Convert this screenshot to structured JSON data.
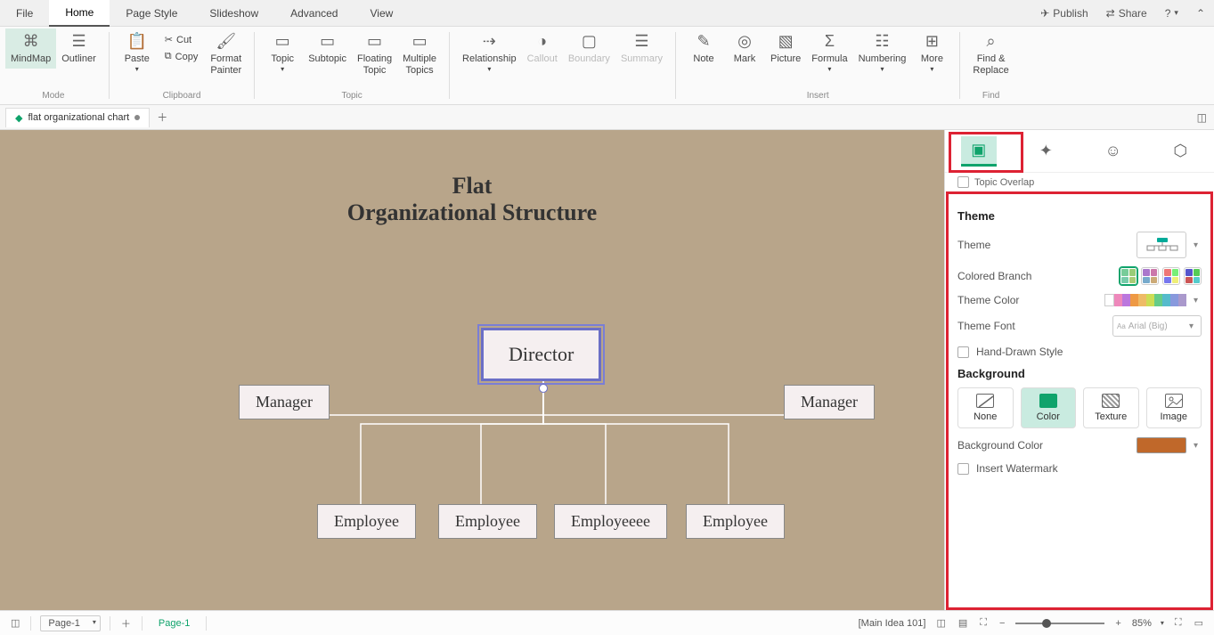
{
  "menu": {
    "file": "File",
    "home": "Home",
    "pagestyle": "Page Style",
    "slideshow": "Slideshow",
    "advanced": "Advanced",
    "view": "View",
    "publish": "Publish",
    "share": "Share"
  },
  "ribbon": {
    "mindmap": "MindMap",
    "outliner": "Outliner",
    "mode": "Mode",
    "paste": "Paste",
    "cut": "Cut",
    "copy": "Copy",
    "format_painter": "Format\nPainter",
    "clipboard": "Clipboard",
    "topic": "Topic",
    "subtopic": "Subtopic",
    "floating_topic": "Floating\nTopic",
    "multiple_topics": "Multiple\nTopics",
    "topic_grp": "Topic",
    "relationship": "Relationship",
    "callout": "Callout",
    "boundary": "Boundary",
    "summary": "Summary",
    "note": "Note",
    "mark": "Mark",
    "picture": "Picture",
    "formula": "Formula",
    "numbering": "Numbering",
    "more": "More",
    "insert": "Insert",
    "find_replace": "Find &\nReplace",
    "find": "Find"
  },
  "tabs": {
    "doc": "flat organizational chart"
  },
  "canvas": {
    "title_l1": "Flat",
    "title_l2": "Organizational Structure",
    "director": "Director",
    "manager1": "Manager",
    "manager2": "Manager",
    "emp1": "Employee",
    "emp2": "Employee",
    "emp3": "Employeeee",
    "emp4": "Employee"
  },
  "panel": {
    "topic_overlap": "Topic Overlap",
    "theme_sec": "Theme",
    "theme_label": "Theme",
    "colored_branch": "Colored Branch",
    "theme_color": "Theme Color",
    "theme_font": "Theme Font",
    "theme_font_value": "Arial (Big)",
    "hand_drawn": "Hand-Drawn Style",
    "background_sec": "Background",
    "bg_none": "None",
    "bg_color": "Color",
    "bg_texture": "Texture",
    "bg_image": "Image",
    "bg_color_label": "Background Color",
    "insert_watermark": "Insert Watermark"
  },
  "status": {
    "page_dd": "Page-1",
    "page_tab": "Page-1",
    "main_idea": "[Main Idea 101]",
    "zoom": "85%"
  }
}
